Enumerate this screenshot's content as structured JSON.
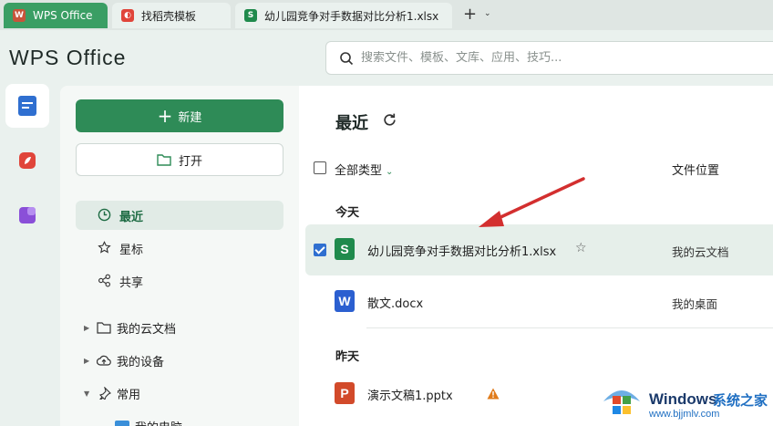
{
  "tabs": [
    {
      "label": "WPS Office"
    },
    {
      "label": "找稻壳模板"
    },
    {
      "label": "幼儿园竞争对手数据对比分析1.xlsx"
    }
  ],
  "tab_add": "+",
  "logo_text": "WPS Office",
  "search": {
    "placeholder": "搜索文件、模板、文库、应用、技巧..."
  },
  "sidebar": {
    "new_label": "新建",
    "open_label": "打开",
    "nav": [
      {
        "label": "最近",
        "icon": "clock-icon"
      },
      {
        "label": "星标",
        "icon": "star-icon"
      },
      {
        "label": "共享",
        "icon": "share-icon"
      }
    ],
    "tree": [
      {
        "label": "我的云文档",
        "icon": "folder-icon"
      },
      {
        "label": "我的设备",
        "icon": "cloud-upload-icon"
      },
      {
        "label": "常用",
        "icon": "pin-icon"
      },
      {
        "label": "我的电脑",
        "icon": "computer-icon"
      }
    ]
  },
  "main": {
    "title": "最近",
    "filter_label": "全部类型",
    "location_header": "文件位置",
    "groups": {
      "today": "今天",
      "yesterday": "昨天"
    },
    "files": [
      {
        "letter": "S",
        "name": "幼儿园竞争对手数据对比分析1.xlsx",
        "location": "我的云文档",
        "color": "#1f8a4c",
        "selected": true
      },
      {
        "letter": "W",
        "name": "散文.docx",
        "location": "我的桌面",
        "color": "#2b5fd0",
        "selected": false
      },
      {
        "letter": "P",
        "name": "演示文稿1.pptx",
        "location": "",
        "color": "#d24a2a",
        "selected": false
      }
    ]
  },
  "watermark": {
    "brand": "Windows",
    "cn": "系统之家",
    "url": "www.bjjmlv.com"
  },
  "colors": {
    "accent": "#2e8b57",
    "arrow": "#d32f2f",
    "selected_row": "#e6efea"
  }
}
